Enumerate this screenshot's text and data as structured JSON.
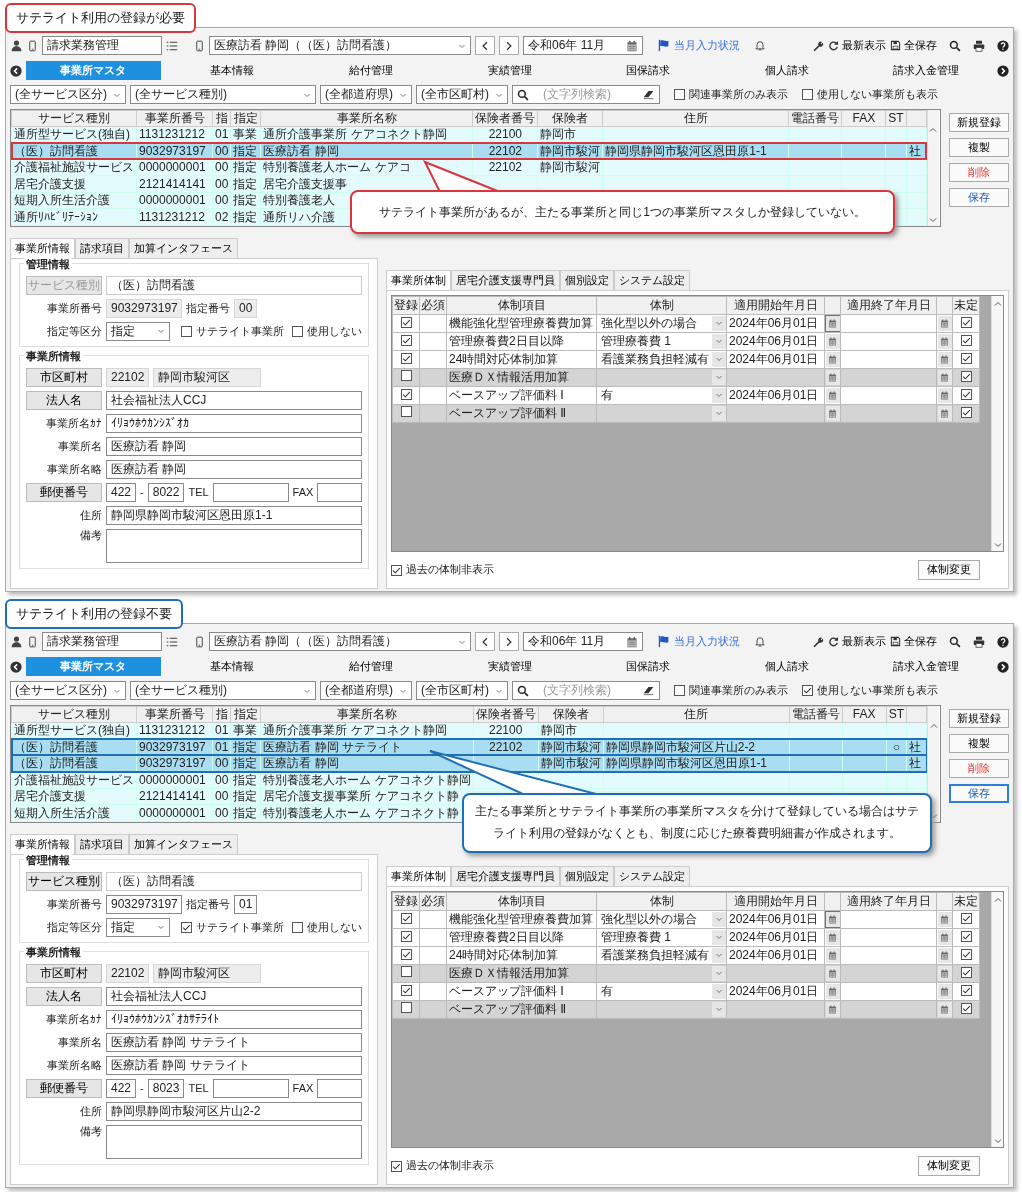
{
  "panels": [
    {
      "title": "サテライト利用の登録が必要",
      "color": "#d9363e",
      "toolbar": {
        "mode": "請求業務管理",
        "office": "医療訪看 静岡（（医）訪問看護）",
        "month": "令和06年 11月",
        "status_link": "当月入力状況",
        "refresh": "最新表示",
        "save_all": "全保存"
      },
      "nav": [
        {
          "label": "事業所マスタ",
          "selected": true
        },
        {
          "label": "基本情報",
          "selected": false
        },
        {
          "label": "給付管理",
          "selected": false
        },
        {
          "label": "実績管理",
          "selected": false
        },
        {
          "label": "国保請求",
          "selected": false
        },
        {
          "label": "個人請求",
          "selected": false
        },
        {
          "label": "請求入金管理",
          "selected": false
        }
      ],
      "filters": {
        "dropdowns": [
          "(全サービス区分)",
          "(全サービス種別)",
          "(全都道府県)",
          "(全市区町村)"
        ],
        "search_placeholder": "(文字列検索)",
        "checks": [
          {
            "label": "関連事業所のみ表示",
            "checked": false
          },
          {
            "label": "使用しない事業所も表示",
            "checked": false
          }
        ]
      },
      "list": {
        "columns": [
          "サービス種別",
          "事業所番号",
          "指",
          "指定",
          "事業所名称",
          "保険者番号",
          "保険者",
          "住所",
          "電話番号",
          "FAX",
          "ST"
        ],
        "rows": [
          {
            "selected": false,
            "service": "通所型サービス(独自)",
            "number": "1131231212",
            "code": "01",
            "designation": "事業",
            "name": "通所介護事業所 ケアコネクト静岡",
            "insurer_number": "22100",
            "insurer": "静岡市"
          },
          {
            "selected": true,
            "service": "（医）訪問看護",
            "number": "9032973197",
            "code": "00",
            "designation": "指定",
            "name": "医療訪看 静岡",
            "insurer_number": "22102",
            "insurer": "静岡市駿河",
            "address": "静岡県静岡市駿河区恩田原1-1",
            "column_12": "社"
          },
          {
            "selected": false,
            "service": "介護福祉施設サービス",
            "number": "0000000001",
            "code": "00",
            "designation": "指定",
            "name": "特別養護老人ホーム ケアコ",
            "insurer_number": "22102",
            "insurer": "静岡市駿河"
          },
          {
            "selected": false,
            "service": "居宅介護支援",
            "number": "2121414141",
            "code": "00",
            "designation": "指定",
            "name": "居宅介護支援事"
          },
          {
            "selected": false,
            "service": "短期入所生活介護",
            "number": "0000000001",
            "code": "00",
            "designation": "指定",
            "name": "特別養護老人"
          },
          {
            "selected": false,
            "service": "通所ﾘﾊﾋﾞﾘﾃｰｼｮﾝ",
            "number": "1131231212",
            "code": "02",
            "designation": "指定",
            "name": "通所リハ介護"
          }
        ]
      },
      "actions": [
        {
          "label": "新規登録",
          "kind": "normal",
          "focused": false
        },
        {
          "label": "複製",
          "kind": "normal",
          "focused": false
        },
        {
          "label": "削除",
          "kind": "danger",
          "focused": false
        },
        {
          "label": "保存",
          "kind": "save",
          "focused": false
        }
      ],
      "left_tabs": [
        {
          "label": "事業所情報",
          "selected": true
        },
        {
          "label": "請求項目",
          "selected": false
        },
        {
          "label": "加算インタフェース",
          "selected": false
        }
      ],
      "form": {
        "locked": true,
        "management_caption": "管理情報",
        "service_type_button": "サービス種別",
        "service_type": "（医）訪問看護",
        "office_number_label": "事業所番号",
        "office_number": "9032973197",
        "designation_number_label": "指定番号",
        "designation_number": "00",
        "designation_type_label": "指定等区分",
        "designation_type": "指定",
        "satellite": {
          "label": "サテライト事業所",
          "checked": false
        },
        "unused": {
          "label": "使用しない",
          "checked": false
        },
        "office_caption": "事業所情報",
        "city_button": "市区町村",
        "city_code": "22102",
        "city_name": "静岡市駿河区",
        "corporation_button": "法人名",
        "corporation": "社会福祉法人CCJ",
        "kana_label": "事業所名ｶﾅ",
        "kana": "ｲﾘｮｳﾎｳｶﾝｼｽﾞｵｶ",
        "name_label": "事業所名",
        "name": "医療訪看 静岡",
        "short_name_label": "事業所名略",
        "short_name": "医療訪看 静岡",
        "postal_button": "郵便番号",
        "postal_1": "422",
        "postal_separator": "-",
        "postal_2": "8022",
        "tel_label": "TEL",
        "fax_label": "FAX",
        "address_label": "住所",
        "address": "静岡県静岡市駿河区恩田原1-1",
        "note_label": "備考"
      },
      "right_tabs": [
        {
          "label": "事業所体制",
          "selected": true
        },
        {
          "label": "居宅介護支援専門員",
          "selected": false
        },
        {
          "label": "個別設定",
          "selected": false
        },
        {
          "label": "システム設定",
          "selected": false
        }
      ],
      "grid": {
        "columns": [
          "登録",
          "必須",
          "体制項目",
          "体制",
          "適用開始年月日",
          "適用終了年月日",
          "未定"
        ],
        "rows": [
          {
            "registered": true,
            "item": "機能強化型管理療養費加算",
            "setting": "強化型以外の場合",
            "start": "2024年06月01日",
            "focused": true,
            "undecided": true
          },
          {
            "registered": true,
            "item": "管理療養費2日目以降",
            "setting": "管理療養費 1",
            "start": "2024年06月01日",
            "focused": false,
            "undecided": true
          },
          {
            "registered": true,
            "item": "24時間対応体制加算",
            "setting": "看護業務負担軽減有",
            "start": "2024年06月01日",
            "focused": false,
            "undecided": true
          },
          {
            "registered": false,
            "item": "医療ＤＸ情報活用加算",
            "focused": false,
            "undecided": true
          },
          {
            "registered": true,
            "item": "ベースアップ評価料 Ⅰ",
            "setting": "有",
            "start": "2024年06月01日",
            "focused": false,
            "undecided": true
          },
          {
            "registered": false,
            "item": "ベースアップ評価料 Ⅱ",
            "focused": false,
            "undecided": true
          }
        ]
      },
      "hide_past": {
        "label": "過去の体制非表示",
        "checked": true
      },
      "change_button": "体制変更",
      "callout": "サテライト事業所があるが、主たる事業所と同じ1つの事業所マスタしか登録していない。"
    },
    {
      "title": "サテライト利用の登録不要",
      "color": "#1f6fb5",
      "toolbar": {
        "mode": "請求業務管理",
        "office": "医療訪看 静岡（（医）訪問看護）",
        "month": "令和06年 11月",
        "status_link": "当月入力状況",
        "refresh": "最新表示",
        "save_all": "全保存"
      },
      "nav": [
        {
          "label": "事業所マスタ",
          "selected": true
        },
        {
          "label": "基本情報",
          "selected": false
        },
        {
          "label": "給付管理",
          "selected": false
        },
        {
          "label": "実績管理",
          "selected": false
        },
        {
          "label": "国保請求",
          "selected": false
        },
        {
          "label": "個人請求",
          "selected": false
        },
        {
          "label": "請求入金管理",
          "selected": false
        }
      ],
      "filters": {
        "dropdowns": [
          "(全サービス区分)",
          "(全サービス種別)",
          "(全都道府県)",
          "(全市区町村)"
        ],
        "search_placeholder": "(文字列検索)",
        "checks": [
          {
            "label": "関連事業所のみ表示",
            "checked": false
          },
          {
            "label": "使用しない事業所も表示",
            "checked": true
          }
        ]
      },
      "list": {
        "columns": [
          "サービス種別",
          "事業所番号",
          "指",
          "指定",
          "事業所名称",
          "保険者番号",
          "保険者",
          "住所",
          "電話番号",
          "FAX",
          "ST"
        ],
        "rows": [
          {
            "selected": false,
            "service": "通所型サービス(独自)",
            "number": "1131231212",
            "code": "01",
            "designation": "事業",
            "name": "通所介護事業所 ケアコネクト静岡",
            "insurer_number": "22100",
            "insurer": "静岡市"
          },
          {
            "selected": true,
            "service": "（医）訪問看護",
            "number": "9032973197",
            "code": "01",
            "designation": "指定",
            "name": "医療訪看 静岡 サテライト",
            "insurer_number": "22102",
            "insurer": "静岡市駿河",
            "address": "静岡県静岡市駿河区片山2-2",
            "st": "○",
            "column_12": "社"
          },
          {
            "selected": true,
            "service": "（医）訪問看護",
            "number": "9032973197",
            "code": "00",
            "designation": "指定",
            "name": "医療訪看 静岡",
            "insurer": "静岡市駿河",
            "address": "静岡県静岡市駿河区恩田原1-1",
            "column_12": "社"
          },
          {
            "selected": false,
            "service": "介護福祉施設サービス",
            "number": "0000000001",
            "code": "00",
            "designation": "指定",
            "name": "特別養護老人ホーム ケアコネクト静岡"
          },
          {
            "selected": false,
            "service": "居宅介護支援",
            "number": "2121414141",
            "code": "00",
            "designation": "指定",
            "name": "居宅介護支援事業所 ケアコネクト静"
          },
          {
            "selected": false,
            "service": "短期入所生活介護",
            "number": "0000000001",
            "code": "00",
            "designation": "指定",
            "name": "特別養護老人ホーム ケアコネクト静"
          }
        ]
      },
      "actions": [
        {
          "label": "新規登録",
          "kind": "normal",
          "focused": false
        },
        {
          "label": "複製",
          "kind": "normal",
          "focused": false
        },
        {
          "label": "削除",
          "kind": "danger",
          "focused": false
        },
        {
          "label": "保存",
          "kind": "save",
          "focused": true
        }
      ],
      "left_tabs": [
        {
          "label": "事業所情報",
          "selected": true
        },
        {
          "label": "請求項目",
          "selected": false
        },
        {
          "label": "加算インタフェース",
          "selected": false
        }
      ],
      "form": {
        "locked": false,
        "management_caption": "管理情報",
        "service_type_button": "サービス種別",
        "service_type": "（医）訪問看護",
        "office_number_label": "事業所番号",
        "office_number": "9032973197",
        "designation_number_label": "指定番号",
        "designation_number": "01",
        "designation_type_label": "指定等区分",
        "designation_type": "指定",
        "satellite": {
          "label": "サテライト事業所",
          "checked": true
        },
        "unused": {
          "label": "使用しない",
          "checked": false
        },
        "office_caption": "事業所情報",
        "city_button": "市区町村",
        "city_code": "22102",
        "city_name": "静岡市駿河区",
        "corporation_button": "法人名",
        "corporation": "社会福祉法人CCJ",
        "kana_label": "事業所名ｶﾅ",
        "kana": "ｲﾘｮｳﾎｳｶﾝｼｽﾞｵｶｻﾃﾗｲﾄ",
        "name_label": "事業所名",
        "name": "医療訪看 静岡 サテライト",
        "short_name_label": "事業所名略",
        "short_name": "医療訪看 静岡 サテライト",
        "postal_button": "郵便番号",
        "postal_1": "422",
        "postal_separator": "-",
        "postal_2": "8023",
        "tel_label": "TEL",
        "fax_label": "FAX",
        "address_label": "住所",
        "address": "静岡県静岡市駿河区片山2-2",
        "note_label": "備考"
      },
      "right_tabs": [
        {
          "label": "事業所体制",
          "selected": true
        },
        {
          "label": "居宅介護支援専門員",
          "selected": false
        },
        {
          "label": "個別設定",
          "selected": false
        },
        {
          "label": "システム設定",
          "selected": false
        }
      ],
      "grid": {
        "columns": [
          "登録",
          "必須",
          "体制項目",
          "体制",
          "適用開始年月日",
          "適用終了年月日",
          "未定"
        ],
        "rows": [
          {
            "registered": true,
            "item": "機能強化型管理療養費加算",
            "setting": "強化型以外の場合",
            "start": "2024年06月01日",
            "focused": true,
            "undecided": true
          },
          {
            "registered": true,
            "item": "管理療養費2日目以降",
            "setting": "管理療養費 1",
            "start": "2024年06月01日",
            "focused": false,
            "undecided": true
          },
          {
            "registered": true,
            "item": "24時間対応体制加算",
            "setting": "看護業務負担軽減有",
            "start": "2024年06月01日",
            "focused": false,
            "undecided": true
          },
          {
            "registered": false,
            "item": "医療ＤＸ情報活用加算",
            "focused": false,
            "undecided": true
          },
          {
            "registered": true,
            "item": "ベースアップ評価料 Ⅰ",
            "setting": "有",
            "start": "2024年06月01日",
            "focused": false,
            "undecided": true
          },
          {
            "registered": false,
            "item": "ベースアップ評価料 Ⅱ",
            "focused": false,
            "undecided": true
          }
        ]
      },
      "hide_past": {
        "label": "過去の体制非表示",
        "checked": true
      },
      "change_button": "体制変更",
      "callout": "主たる事業所とサテライト事業所の事業所マスタを分けて登録している場合はサテライト利用の登録がなくとも、制度に応じた療養費明細書が作成されます。"
    }
  ]
}
